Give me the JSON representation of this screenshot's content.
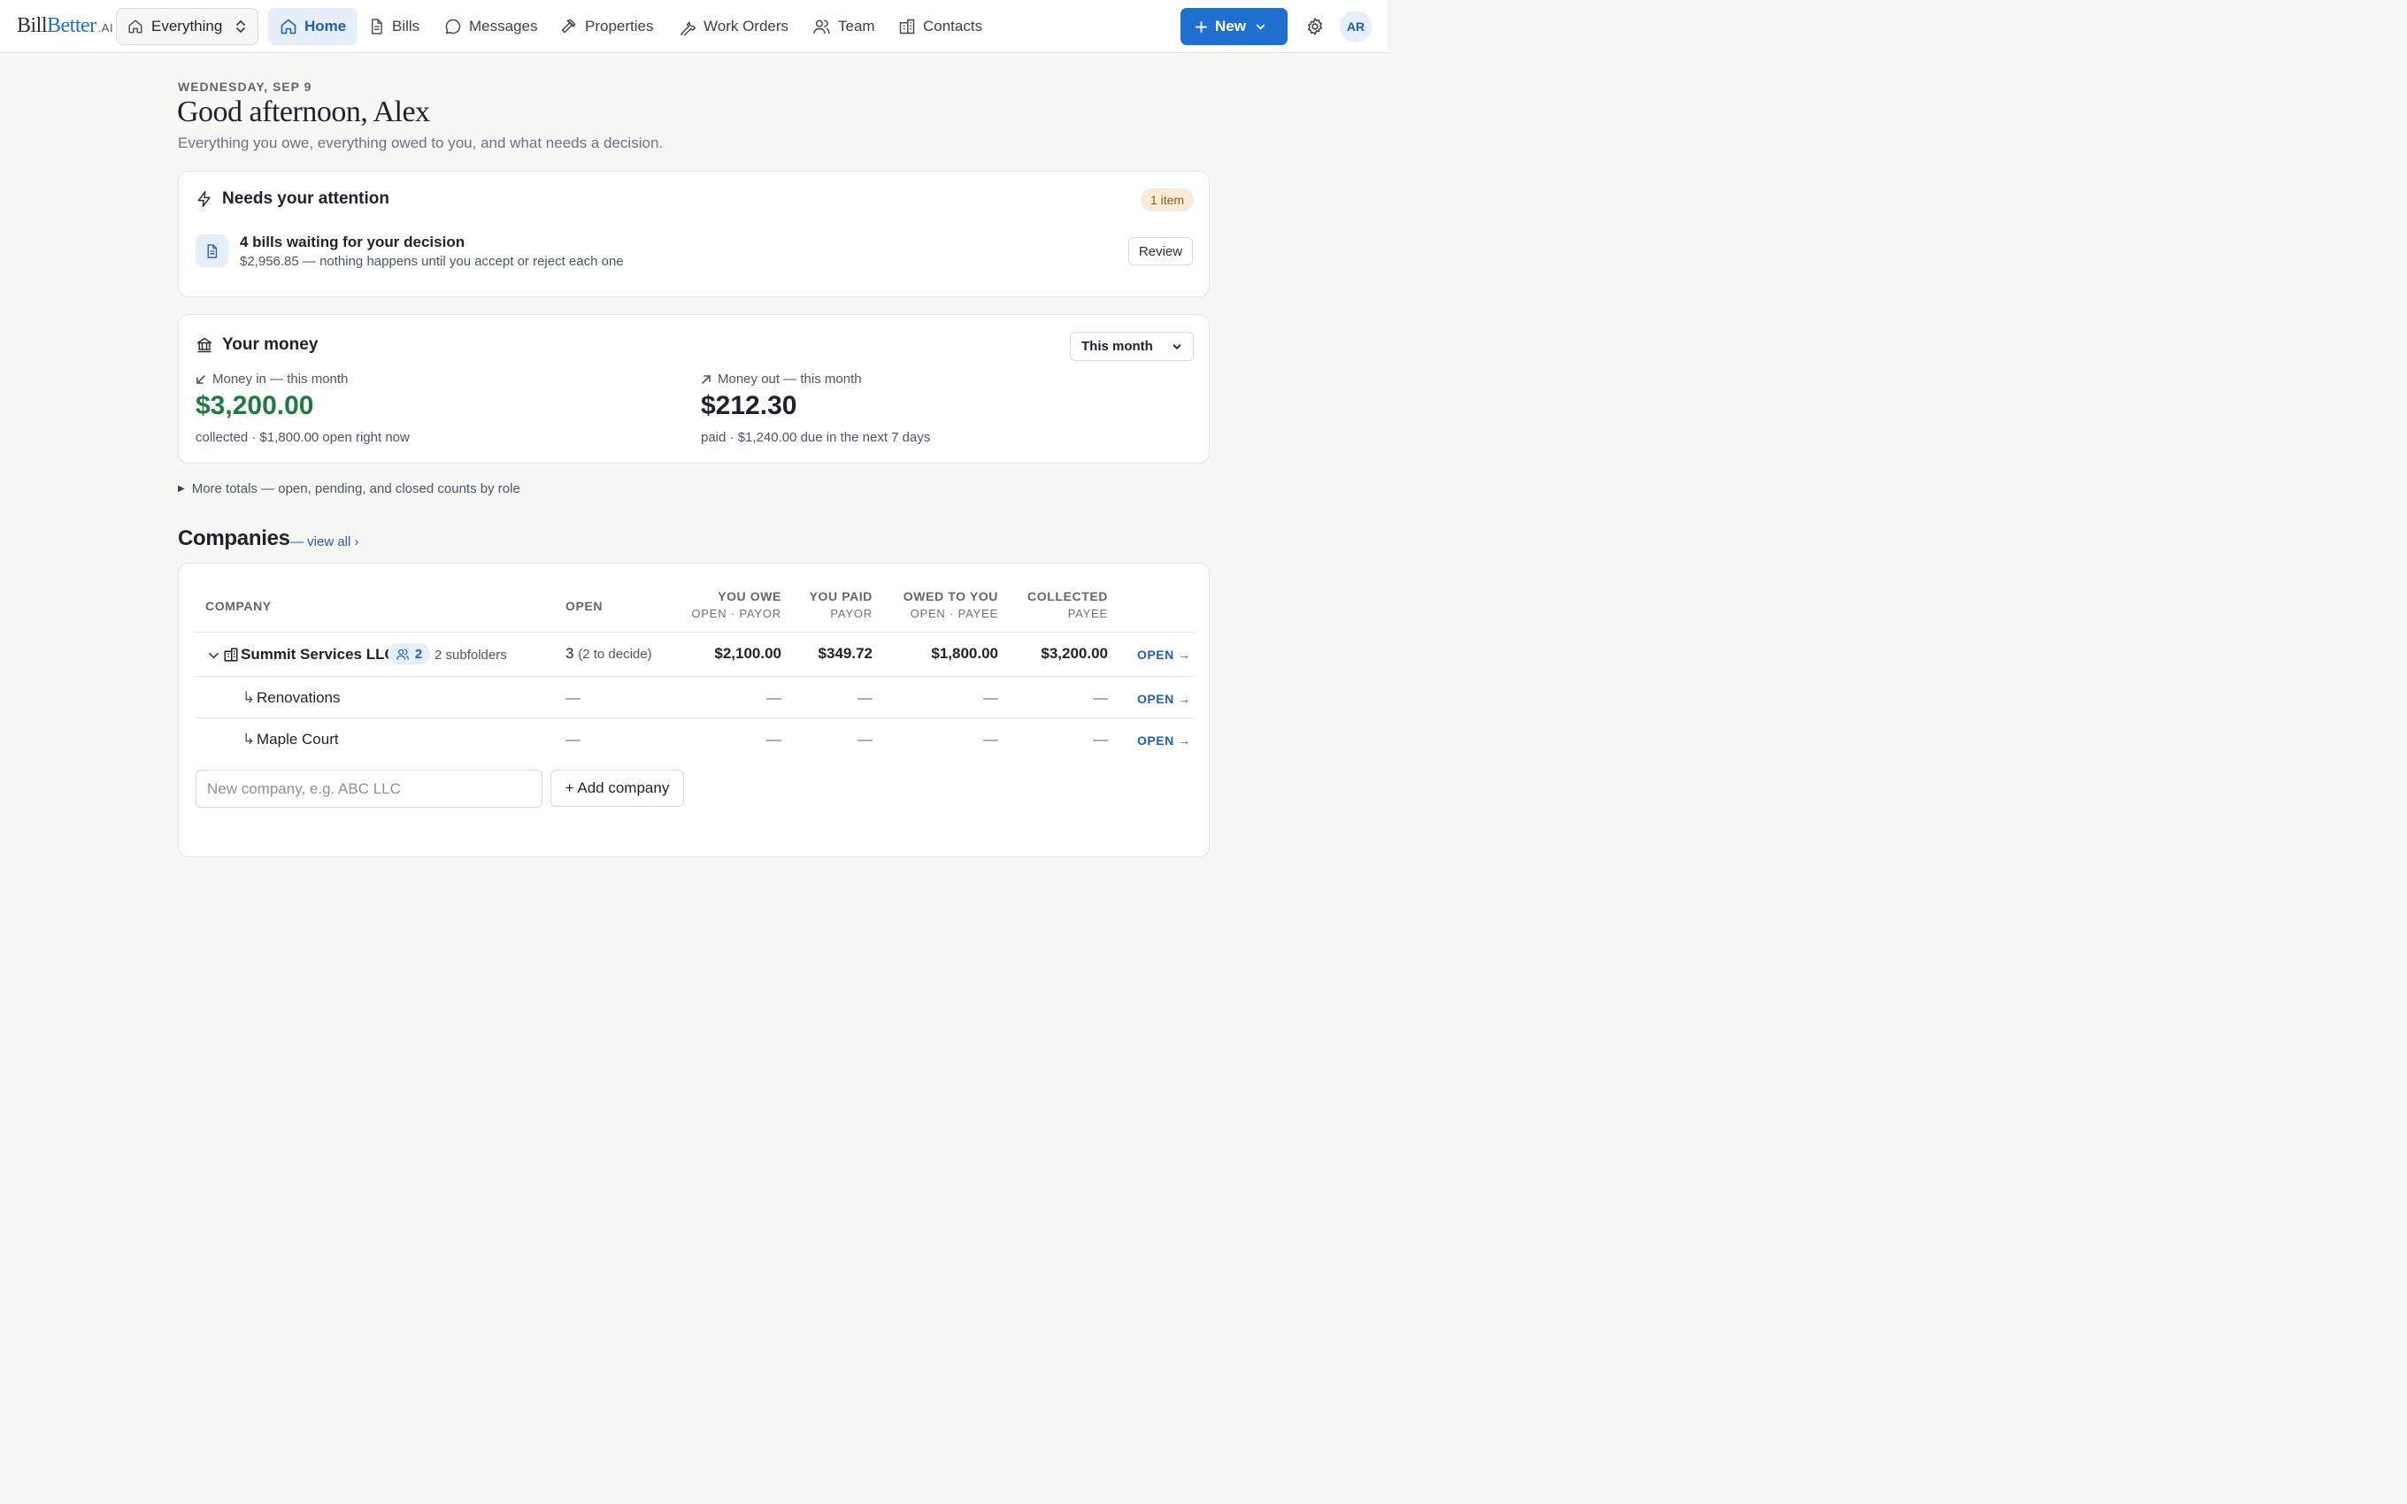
{
  "app": {
    "logo": {
      "bill": "Bill",
      "better": "Better",
      "ai": ".AI"
    },
    "scope_selector": "Everything",
    "nav": [
      {
        "label": "Home",
        "icon": "home-icon",
        "active": true
      },
      {
        "label": "Bills",
        "icon": "document-icon"
      },
      {
        "label": "Messages",
        "icon": "message-icon"
      },
      {
        "label": "Properties",
        "icon": "hammer-icon"
      },
      {
        "label": "Work Orders",
        "icon": "wrench-icon"
      },
      {
        "label": "Team",
        "icon": "users-icon"
      },
      {
        "label": "Contacts",
        "icon": "building-icon"
      }
    ],
    "new_button": "New",
    "avatar_initials": "AR"
  },
  "header": {
    "date": "WEDNESDAY, SEP 9",
    "greeting": "Good afternoon, Alex",
    "subtitle": "Everything you owe, everything owed to you, and what needs a decision."
  },
  "attention": {
    "title": "Needs your attention",
    "badge": "1 item",
    "item_title": "4 bills waiting for your decision",
    "item_subtitle": "$2,956.85 — nothing happens until you accept or reject each one",
    "action": "Review"
  },
  "money": {
    "title": "Your money",
    "period": "This month",
    "money_in": {
      "label": "Money in — this month",
      "value": "$3,200.00",
      "note": "collected · $1,800.00 open right now"
    },
    "money_out": {
      "label": "Money out — this month",
      "value": "$212.30",
      "note": "paid · $1,240.00 due in the next 7 days"
    }
  },
  "more_totals": "More totals — open, pending, and closed counts by role",
  "companies": {
    "heading": "Companies",
    "view_all": "— view all ›",
    "columns": {
      "company": "COMPANY",
      "open": "OPEN",
      "you_owe": "YOU OWE",
      "you_owe_sub": "OPEN · PAYOR",
      "you_paid": "YOU PAID",
      "you_paid_sub": "PAYOR",
      "owed_to_you": "OWED TO YOU",
      "owed_to_you_sub": "OPEN · PAYEE",
      "collected": "COLLECTED",
      "collected_sub": "PAYEE"
    },
    "rows": [
      {
        "name": "Summit Services LLC",
        "members": "2",
        "subfolders": "2 subfolders",
        "open_count": "3",
        "open_note": "(2 to decide)",
        "you_owe": "$2,100.00",
        "you_paid": "$349.72",
        "owed_to_you": "$1,800.00",
        "collected": "$3,200.00",
        "action": "OPEN →"
      },
      {
        "name": "Renovations",
        "prefix": "↳",
        "open_count": "—",
        "you_owe": "—",
        "you_paid": "—",
        "owed_to_you": "—",
        "collected": "—",
        "action": "OPEN →"
      },
      {
        "name": "Maple Court",
        "prefix": "↳",
        "open_count": "—",
        "you_owe": "—",
        "you_paid": "—",
        "owed_to_you": "—",
        "collected": "—",
        "action": "OPEN →"
      }
    ],
    "new_company_placeholder": "New company, e.g. ABC LLC",
    "add_company": "+ Add company"
  },
  "colors": {
    "accent": "#1f6fd1",
    "money_in": "#1f7a3f",
    "badge_bg": "#f8ecd9",
    "badge_text": "#8a5a17"
  }
}
